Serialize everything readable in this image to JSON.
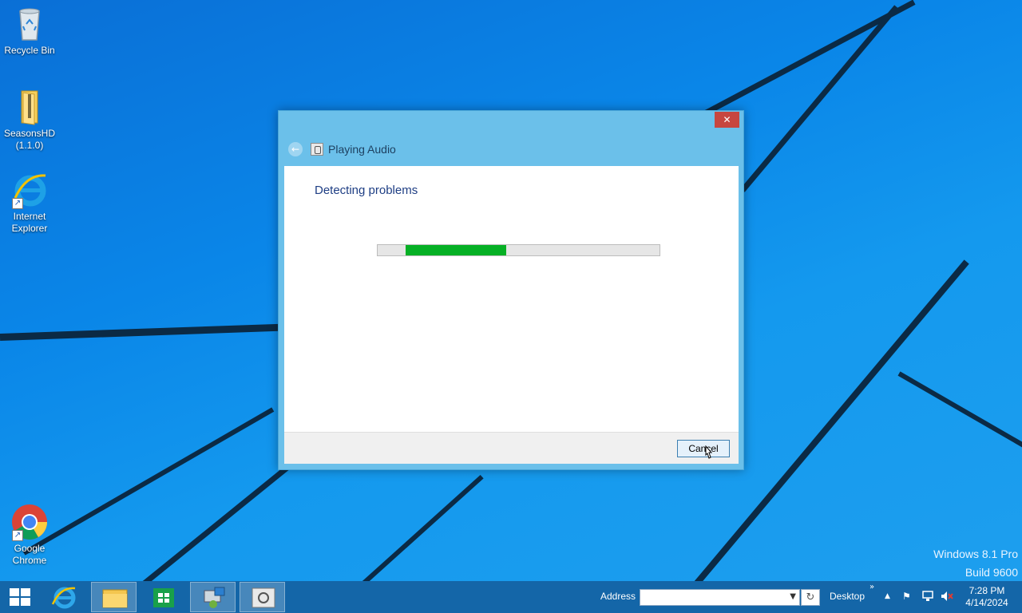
{
  "desktop": {
    "icons": [
      {
        "label": "Recycle Bin"
      },
      {
        "label": "SeasonsHD (1.1.0)"
      },
      {
        "label": "Internet Explorer"
      },
      {
        "label": "Google Chrome"
      }
    ],
    "watermark": {
      "line1": "Windows 8.1 Pro",
      "line2": "Build 9600"
    }
  },
  "dialog": {
    "title": "Playing Audio",
    "close_label": "✕",
    "back_label": "←",
    "heading": "Detecting problems",
    "progress": {
      "segment_start_fraction": 0.1,
      "segment_end_fraction": 0.458,
      "color": "#06b025"
    },
    "cancel_label": "Cancel"
  },
  "taskbar": {
    "pinned": [
      {
        "name": "internet-explorer"
      },
      {
        "name": "file-explorer"
      },
      {
        "name": "windows-store"
      },
      {
        "name": "installer"
      },
      {
        "name": "troubleshooter"
      }
    ],
    "address_label": "Address",
    "address_value": "",
    "desktop_label": "Desktop",
    "clock": {
      "time": "7:28 PM",
      "date": "4/14/2024"
    }
  }
}
